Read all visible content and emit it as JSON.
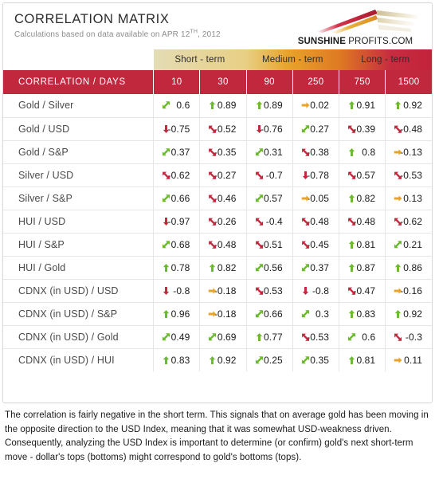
{
  "header": {
    "title": "CORRELATION MATRIX",
    "subtitle_prefix": "Calculations based on data available on",
    "date_main": "APR 12",
    "date_sup": "TH",
    "date_year": ", 2012",
    "logo_bold": "SUNSHINE",
    "logo_light": " PROFITS.COM"
  },
  "colors": {
    "header_red": "#c1273d",
    "positive_green": "#6cb92e",
    "negative_red": "#c1273d",
    "neutral_orange": "#e8a32a",
    "band_cream": "#e4dcb4",
    "band_gold": "#e8a32a",
    "band_red": "#c3223b"
  },
  "table": {
    "bands": [
      {
        "label": "Short - term",
        "span": 2
      },
      {
        "label": "Medium - term",
        "span": 2
      },
      {
        "label": "Long - term",
        "span": 2
      }
    ],
    "corner_label": "CORRELATION / DAYS",
    "columns": [
      "10",
      "30",
      "90",
      "250",
      "750",
      "1500"
    ],
    "rows": [
      {
        "label": "Gold / Silver",
        "cells": [
          {
            "value": "0.6",
            "arrow": "up-diagonal"
          },
          {
            "value": "0.89",
            "arrow": "up"
          },
          {
            "value": "0.89",
            "arrow": "up"
          },
          {
            "value": "0.02",
            "arrow": "right"
          },
          {
            "value": "0.91",
            "arrow": "up"
          },
          {
            "value": "0.92",
            "arrow": "up"
          }
        ]
      },
      {
        "label": "Gold / USD",
        "cells": [
          {
            "value": "-0.75",
            "arrow": "down"
          },
          {
            "value": "-0.52",
            "arrow": "down-diagonal"
          },
          {
            "value": "-0.76",
            "arrow": "down"
          },
          {
            "value": "0.27",
            "arrow": "up-diagonal"
          },
          {
            "value": "-0.39",
            "arrow": "down-diagonal"
          },
          {
            "value": "-0.48",
            "arrow": "down-diagonal"
          }
        ]
      },
      {
        "label": "Gold / S&P",
        "cells": [
          {
            "value": "0.37",
            "arrow": "up-diagonal"
          },
          {
            "value": "-0.35",
            "arrow": "down-diagonal"
          },
          {
            "value": "0.31",
            "arrow": "up-diagonal"
          },
          {
            "value": "-0.38",
            "arrow": "down-diagonal"
          },
          {
            "value": "0.8",
            "arrow": "up"
          },
          {
            "value": "-0.13",
            "arrow": "right"
          }
        ]
      },
      {
        "label": "Silver / USD",
        "cells": [
          {
            "value": "-0.62",
            "arrow": "down-diagonal"
          },
          {
            "value": "-0.27",
            "arrow": "down-diagonal"
          },
          {
            "value": "-0.7",
            "arrow": "down-diagonal"
          },
          {
            "value": "-0.78",
            "arrow": "down"
          },
          {
            "value": "-0.57",
            "arrow": "down-diagonal"
          },
          {
            "value": "-0.53",
            "arrow": "down-diagonal"
          }
        ]
      },
      {
        "label": "Silver / S&P",
        "cells": [
          {
            "value": "0.66",
            "arrow": "up-diagonal"
          },
          {
            "value": "-0.46",
            "arrow": "down-diagonal"
          },
          {
            "value": "0.57",
            "arrow": "up-diagonal"
          },
          {
            "value": "-0.05",
            "arrow": "right"
          },
          {
            "value": "0.82",
            "arrow": "up"
          },
          {
            "value": "0.13",
            "arrow": "right"
          }
        ]
      },
      {
        "label": "HUI / USD",
        "cells": [
          {
            "value": "-0.97",
            "arrow": "down"
          },
          {
            "value": "-0.26",
            "arrow": "down-diagonal"
          },
          {
            "value": "-0.4",
            "arrow": "down-diagonal"
          },
          {
            "value": "-0.48",
            "arrow": "down-diagonal"
          },
          {
            "value": "-0.48",
            "arrow": "down-diagonal"
          },
          {
            "value": "-0.62",
            "arrow": "down-diagonal"
          }
        ]
      },
      {
        "label": "HUI / S&P",
        "cells": [
          {
            "value": "0.68",
            "arrow": "up-diagonal"
          },
          {
            "value": "-0.48",
            "arrow": "down-diagonal"
          },
          {
            "value": "-0.51",
            "arrow": "down-diagonal"
          },
          {
            "value": "-0.45",
            "arrow": "down-diagonal"
          },
          {
            "value": "0.81",
            "arrow": "up"
          },
          {
            "value": "0.21",
            "arrow": "up-diagonal"
          }
        ]
      },
      {
        "label": "HUI / Gold",
        "cells": [
          {
            "value": "0.78",
            "arrow": "up"
          },
          {
            "value": "0.82",
            "arrow": "up"
          },
          {
            "value": "0.56",
            "arrow": "up-diagonal"
          },
          {
            "value": "0.37",
            "arrow": "up-diagonal"
          },
          {
            "value": "0.87",
            "arrow": "up"
          },
          {
            "value": "0.86",
            "arrow": "up"
          }
        ]
      },
      {
        "label": "CDNX (in USD) / USD",
        "cells": [
          {
            "value": "-0.8",
            "arrow": "down"
          },
          {
            "value": "-0.18",
            "arrow": "right"
          },
          {
            "value": "-0.53",
            "arrow": "down-diagonal"
          },
          {
            "value": "-0.8",
            "arrow": "down"
          },
          {
            "value": "-0.47",
            "arrow": "down-diagonal"
          },
          {
            "value": "-0.16",
            "arrow": "right"
          }
        ]
      },
      {
        "label": "CDNX (in USD) / S&P",
        "cells": [
          {
            "value": "0.96",
            "arrow": "up"
          },
          {
            "value": "-0.18",
            "arrow": "right"
          },
          {
            "value": "0.66",
            "arrow": "up-diagonal"
          },
          {
            "value": "0.3",
            "arrow": "up-diagonal"
          },
          {
            "value": "0.83",
            "arrow": "up"
          },
          {
            "value": "0.92",
            "arrow": "up"
          }
        ]
      },
      {
        "label": "CDNX (in USD) / Gold",
        "cells": [
          {
            "value": "0.49",
            "arrow": "up-diagonal"
          },
          {
            "value": "0.69",
            "arrow": "up-diagonal"
          },
          {
            "value": "0.77",
            "arrow": "up"
          },
          {
            "value": "-0.53",
            "arrow": "down-diagonal"
          },
          {
            "value": "0.6",
            "arrow": "up-diagonal"
          },
          {
            "value": "-0.3",
            "arrow": "down-diagonal"
          }
        ]
      },
      {
        "label": "CDNX (in USD) / HUI",
        "cells": [
          {
            "value": "0.83",
            "arrow": "up"
          },
          {
            "value": "0.92",
            "arrow": "up"
          },
          {
            "value": "0.25",
            "arrow": "up-diagonal"
          },
          {
            "value": "0.35",
            "arrow": "up-diagonal"
          },
          {
            "value": "0.81",
            "arrow": "up"
          },
          {
            "value": "0.11",
            "arrow": "right"
          }
        ]
      }
    ]
  },
  "footnote": "The correlation is fairly negative in the short term. This signals that on average gold has been moving in the opposite direction to the USD Index, meaning that it was somewhat USD-weakness driven. Consequently, analyzing the USD Index is important to determine (or confirm) gold's next short-term move - dollar's tops (bottoms) might correspond to gold's bottoms (tops)."
}
